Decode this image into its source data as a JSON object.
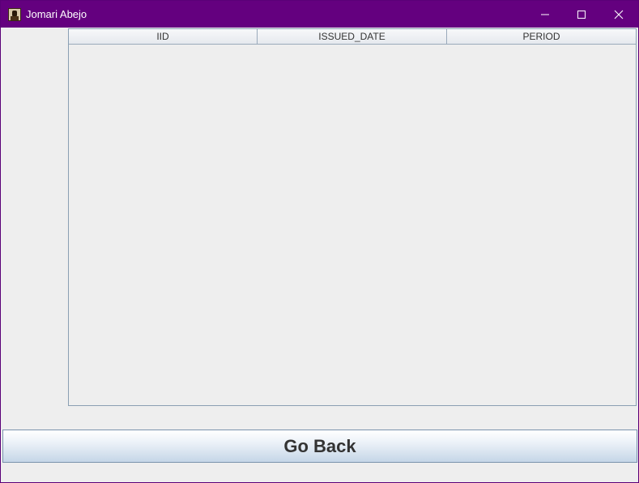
{
  "window": {
    "title": "Jomari Abejo",
    "titlebar_color": "#64007f",
    "icons": {
      "app": "user-avatar-icon",
      "minimize": "minimize-icon",
      "maximize": "maximize-icon",
      "close": "close-icon"
    }
  },
  "table": {
    "columns": [
      "IID",
      "ISSUED_DATE",
      "PERIOD"
    ],
    "rows": []
  },
  "actions": {
    "go_back_label": "Go Back"
  }
}
